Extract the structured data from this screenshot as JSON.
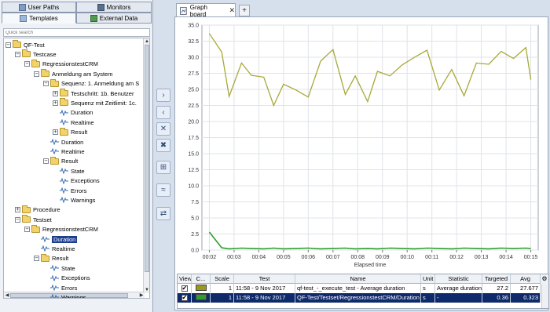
{
  "left_tabs": {
    "user_paths": "User Paths",
    "monitors": "Monitors",
    "templates": "Templates",
    "external_data": "External Data"
  },
  "search": {
    "placeholder": "Quick search"
  },
  "tree": [
    {
      "label": "QF-Test",
      "icon": "folder",
      "expander": "−",
      "level": 0
    },
    {
      "label": "Testcase",
      "icon": "folder",
      "expander": "−",
      "level": 1
    },
    {
      "label": "RegressionstestCRM",
      "icon": "folder",
      "expander": "−",
      "level": 2
    },
    {
      "label": "Anmeldung am System",
      "icon": "folder",
      "expander": "−",
      "level": 3
    },
    {
      "label": "Sequenz: 1. Anmeldung am S",
      "icon": "folder",
      "expander": "−",
      "level": 4
    },
    {
      "label": "Testschritt: 1b. Benutzer",
      "icon": "folder",
      "expander": "+",
      "level": 5
    },
    {
      "label": "Sequenz mit Zeitlimit: 1c.",
      "icon": "folder",
      "expander": "+",
      "level": 5
    },
    {
      "label": "Duration",
      "icon": "wave",
      "expander": "",
      "level": 5
    },
    {
      "label": "Realtime",
      "icon": "wave",
      "expander": "",
      "level": 5
    },
    {
      "label": "Result",
      "icon": "folder",
      "expander": "+",
      "level": 5
    },
    {
      "label": "Duration",
      "icon": "wave",
      "expander": "",
      "level": 4
    },
    {
      "label": "Realtime",
      "icon": "wave",
      "expander": "",
      "level": 4
    },
    {
      "label": "Result",
      "icon": "folder",
      "expander": "−",
      "level": 4
    },
    {
      "label": "State",
      "icon": "wave",
      "expander": "",
      "level": 5
    },
    {
      "label": "Exceptions",
      "icon": "wave",
      "expander": "",
      "level": 5
    },
    {
      "label": "Errors",
      "icon": "wave",
      "expander": "",
      "level": 5
    },
    {
      "label": "Warnings",
      "icon": "wave",
      "expander": "",
      "level": 5
    },
    {
      "label": "Procedure",
      "icon": "folder",
      "expander": "+",
      "level": 1
    },
    {
      "label": "Testset",
      "icon": "folder",
      "expander": "−",
      "level": 1
    },
    {
      "label": "RegressionstestCRM",
      "icon": "folder",
      "expander": "−",
      "level": 2
    },
    {
      "label": "Duration",
      "icon": "wave",
      "expander": "",
      "level": 3,
      "selected": true
    },
    {
      "label": "Realtime",
      "icon": "wave",
      "expander": "",
      "level": 3
    },
    {
      "label": "Result",
      "icon": "folder",
      "expander": "−",
      "level": 3
    },
    {
      "label": "State",
      "icon": "wave",
      "expander": "",
      "level": 4
    },
    {
      "label": "Exceptions",
      "icon": "wave",
      "expander": "",
      "level": 4
    },
    {
      "label": "Errors",
      "icon": "wave",
      "expander": "",
      "level": 4
    },
    {
      "label": "Warnings",
      "icon": "wave",
      "expander": "",
      "level": 4
    }
  ],
  "mid_buttons": [
    {
      "name": "add-button",
      "glyph": "›"
    },
    {
      "name": "remove-button",
      "glyph": "‹"
    },
    {
      "name": "delete-button",
      "glyph": "✕"
    },
    {
      "name": "delete-all-button",
      "glyph": "✖"
    },
    {
      "name": "grid-button",
      "glyph": "⊞"
    },
    {
      "name": "curve-button",
      "glyph": "≈"
    },
    {
      "name": "refresh-button",
      "glyph": "⇄"
    }
  ],
  "doc_tab": {
    "label": "Graph board",
    "close": "✕",
    "add": "+"
  },
  "chart_data": {
    "type": "line",
    "xlabel": "Elapsed time",
    "ylabel": "",
    "x_ticks": [
      "00:02",
      "00:03",
      "00:04",
      "00:05",
      "00:06",
      "00:07",
      "00:08",
      "00:09",
      "00:10",
      "00:11",
      "00:12",
      "00:13",
      "00:14",
      "00:15"
    ],
    "y_ticks": [
      "0.0",
      "2.5",
      "5.0",
      "7.5",
      "10.0",
      "12.5",
      "15.0",
      "17.5",
      "20.0",
      "22.5",
      "25.0",
      "27.5",
      "30.0",
      "32.5",
      "35.0"
    ],
    "ylim": [
      0,
      35
    ],
    "xlim": [
      1.7,
      15.3
    ],
    "grid": true,
    "series": [
      {
        "color": "#a8a83a",
        "x": [
          2.0,
          2.5,
          2.8,
          3.3,
          3.7,
          4.2,
          4.6,
          5.0,
          5.5,
          6.0,
          6.5,
          7.0,
          7.5,
          7.9,
          8.4,
          8.8,
          9.3,
          9.8,
          10.3,
          10.8,
          11.3,
          11.8,
          12.3,
          12.8,
          13.3,
          13.8,
          14.3,
          14.8,
          15.0
        ],
        "y": [
          33.7,
          30.8,
          23.9,
          29.1,
          27.2,
          26.9,
          22.5,
          25.8,
          24.9,
          23.8,
          29.4,
          31.2,
          24.2,
          27.1,
          23.1,
          27.8,
          27.1,
          28.8,
          30.0,
          31.1,
          24.9,
          28.1,
          24.0,
          29.1,
          28.9,
          30.9,
          29.8,
          31.5,
          26.5
        ]
      },
      {
        "color": "#2f9e2f",
        "x": [
          2.0,
          2.5,
          2.8,
          3.3,
          3.7,
          4.2,
          4.6,
          5.0,
          5.5,
          6.0,
          6.5,
          7.0,
          7.5,
          7.9,
          8.4,
          8.8,
          9.3,
          9.8,
          10.3,
          10.8,
          11.3,
          11.8,
          12.3,
          12.8,
          13.3,
          13.8,
          14.3,
          14.8,
          15.0
        ],
        "y": [
          2.8,
          0.35,
          0.2,
          0.3,
          0.25,
          0.2,
          0.3,
          0.2,
          0.25,
          0.3,
          0.2,
          0.25,
          0.3,
          0.2,
          0.25,
          0.2,
          0.3,
          0.25,
          0.2,
          0.3,
          0.25,
          0.2,
          0.3,
          0.25,
          0.2,
          0.3,
          0.25,
          0.3,
          0.25
        ]
      }
    ]
  },
  "table": {
    "headers": [
      "View",
      "C...",
      "Scale",
      "Test",
      "Name",
      "Unit",
      "Statistic",
      "Targeted",
      "Avg"
    ],
    "rows": [
      {
        "view": "✔",
        "color": "#9a9a1a",
        "scale": "1",
        "test": "11:58 - 9 Nov 2017",
        "name": "qf-test_-_execute_test - Average duration",
        "unit": "s",
        "statistic": "Average duration",
        "targeted": "27.2",
        "avg": "27.677",
        "selected": false
      },
      {
        "view": "✔",
        "color": "#2f9e2f",
        "scale": "1",
        "test": "11:58 - 9 Nov 2017",
        "name": "QF-Test/Testset/RegressionstestCRM/Duration",
        "unit": "s",
        "statistic": "-",
        "targeted": "0.36",
        "avg": "0.323",
        "selected": true
      }
    ]
  }
}
